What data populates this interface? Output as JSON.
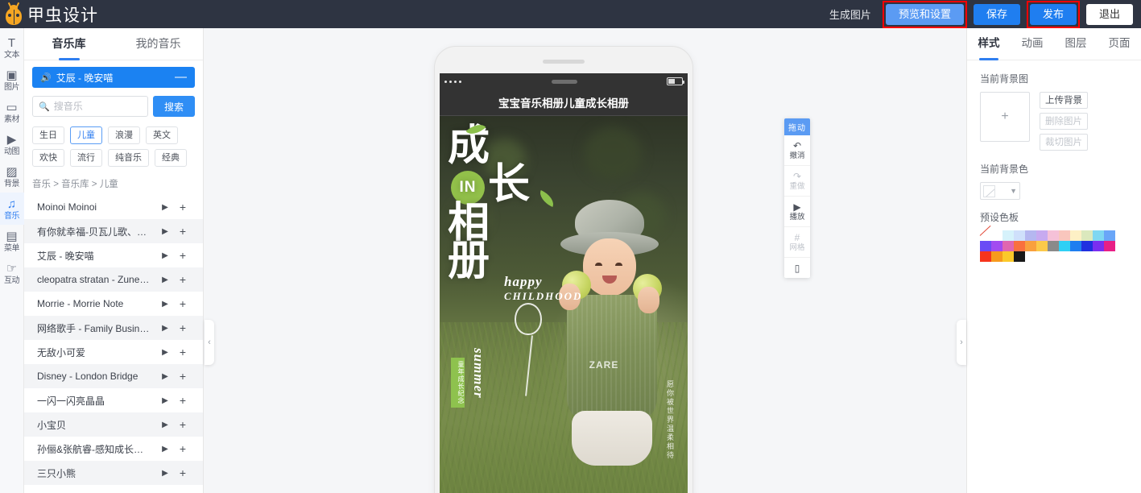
{
  "topbar": {
    "logo_text": "甲虫设计",
    "logo_icon": "beetle-icon",
    "generate_label": "生成图片",
    "preview_label": "预览和设置",
    "save_label": "保存",
    "publish_label": "发布",
    "exit_label": "退出"
  },
  "rail": {
    "items": [
      {
        "label": "文本",
        "icon": "text-icon",
        "glyph": "T"
      },
      {
        "label": "图片",
        "icon": "image-icon",
        "glyph": "▣"
      },
      {
        "label": "素材",
        "icon": "material-folder-icon",
        "glyph": "▭"
      },
      {
        "label": "动图",
        "icon": "gif-icon",
        "glyph": "▶"
      },
      {
        "label": "背景",
        "icon": "background-icon",
        "glyph": "▨"
      },
      {
        "label": "音乐",
        "icon": "music-note-icon",
        "glyph": "♫"
      },
      {
        "label": "菜单",
        "icon": "menu-icon",
        "glyph": "▤"
      },
      {
        "label": "互动",
        "icon": "interaction-hand-icon",
        "glyph": "☞"
      }
    ],
    "active_index": 5
  },
  "left_panel": {
    "tabs": [
      {
        "label": "音乐库"
      },
      {
        "label": "我的音乐"
      }
    ],
    "active_tab": 0,
    "now_playing": {
      "icon": "speaker-icon",
      "title": "艾辰 - 晚安喵",
      "remove_label": "—"
    },
    "search": {
      "placeholder": "搜音乐",
      "value": "",
      "button_label": "搜索",
      "icon": "search-icon"
    },
    "tags": [
      {
        "label": "生日",
        "selected": false
      },
      {
        "label": "儿童",
        "selected": true
      },
      {
        "label": "浪漫",
        "selected": false
      },
      {
        "label": "英文",
        "selected": false
      },
      {
        "label": "欢快",
        "selected": false
      },
      {
        "label": "流行",
        "selected": false
      },
      {
        "label": "纯音乐",
        "selected": false
      },
      {
        "label": "经典",
        "selected": false
      }
    ],
    "breadcrumb": "音乐 > 音乐库 > 儿童",
    "play_icon": "play-icon",
    "add_icon": "plus-icon",
    "songs": [
      "Moinoi Moinoi",
      "有你就幸福-贝瓦儿歌、李...",
      "艾辰 - 晚安喵",
      "cleopatra stratan - Zunea...",
      "Morrie - Morrie Note",
      "网络歌手 - Family Business",
      "无敌小可爱",
      "Disney - London Bridge",
      "一闪一闪亮晶晶",
      "小宝贝",
      "孙俪&张航睿-感知成长的...",
      "三只小熊"
    ]
  },
  "canvas": {
    "collapse_left_icon": "chevron-left-icon",
    "collapse_right_icon": "chevron-right-icon",
    "phone": {
      "page_title": "宝宝音乐相册儿童成长相册",
      "poster": {
        "title_line1": "成",
        "title_line2": "长",
        "title_line3": "相",
        "title_line4": "册",
        "in_badge": "IN",
        "happy_line1": "happy",
        "happy_line2": "CHILDHOOD",
        "green_badge": "童年成长纪念",
        "summer": "summer",
        "vertical_watermark": "愿你被世界温柔相待"
      }
    },
    "toolbar": {
      "drag_label": "拖动",
      "items": [
        {
          "label": "撤消",
          "icon": "undo-icon",
          "glyph": "↶",
          "disabled": false
        },
        {
          "label": "重做",
          "icon": "redo-icon",
          "glyph": "↷",
          "disabled": true
        },
        {
          "label": "播放",
          "icon": "play-icon",
          "glyph": "▶",
          "disabled": false
        },
        {
          "label": "网格",
          "icon": "grid-icon",
          "glyph": "#",
          "disabled": true
        }
      ],
      "device_icon": "phone-icon",
      "device_glyph": "▯"
    }
  },
  "right_panel": {
    "tabs": [
      {
        "label": "样式"
      },
      {
        "label": "动画"
      },
      {
        "label": "图层"
      },
      {
        "label": "页面"
      }
    ],
    "active_tab": 0,
    "bg_image": {
      "label": "当前背景图",
      "add_icon": "plus-icon",
      "add_glyph": "+",
      "upload_label": "上传背景",
      "delete_label": "删除图片",
      "crop_label": "裁切图片"
    },
    "bg_color": {
      "label": "当前背景色",
      "selected": "none",
      "chevron_icon": "chevron-down-icon"
    },
    "palette": {
      "label": "预设色板",
      "row1": [
        "none",
        "#ffffff",
        "#d6f2fb",
        "#cfe0fb",
        "#b5b7f0",
        "#c7aaf0",
        "#f5c1d8",
        "#f9c6bd",
        "#fdf0c5",
        "#dbe8bd",
        "#7fd7f2",
        "#6aa6f8"
      ],
      "row2": [
        "#6a4bf5",
        "#a24bf0",
        "#e066b0",
        "#f9703e",
        "#f9a03e",
        "#fbc94a",
        "#8a8a8a",
        "#2fd0f5",
        "#1e7ef0",
        "#2030e0",
        "#7a2ef0",
        "#e81f86"
      ],
      "row3": [
        "#f6341c",
        "#f79a1e",
        "#fbc92a",
        "#191919"
      ]
    }
  }
}
